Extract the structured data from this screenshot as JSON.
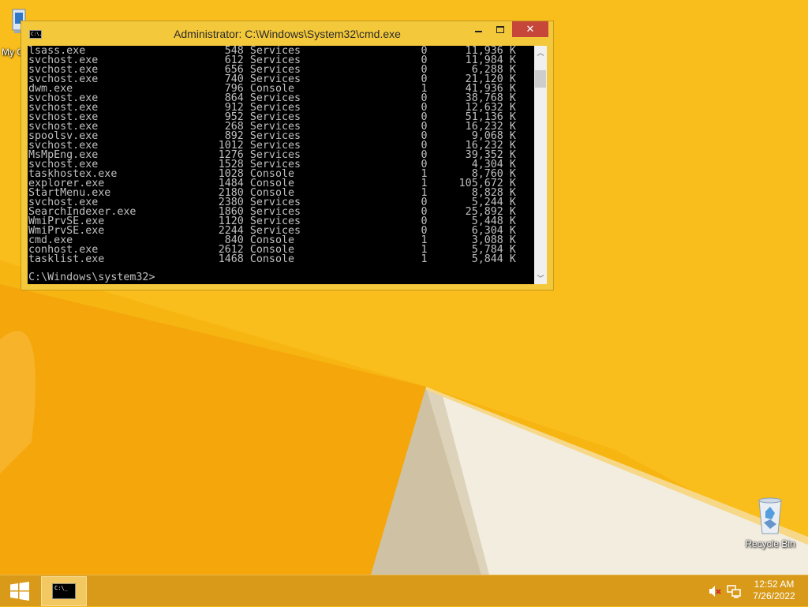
{
  "desktop": {
    "icons": {
      "my_computer": {
        "label": "My C"
      },
      "recycle_bin": {
        "label": "Recycle Bin"
      }
    }
  },
  "window": {
    "title": "Administrator: C:\\Windows\\System32\\cmd.exe",
    "sysicon_text": "C:\\.",
    "close_glyph": "✕"
  },
  "console": {
    "rows": [
      [
        "lsass.exe",
        "548",
        "Services",
        "0",
        "11,936",
        "K"
      ],
      [
        "svchost.exe",
        "612",
        "Services",
        "0",
        "11,984",
        "K"
      ],
      [
        "svchost.exe",
        "656",
        "Services",
        "0",
        "6,288",
        "K"
      ],
      [
        "svchost.exe",
        "740",
        "Services",
        "0",
        "21,120",
        "K"
      ],
      [
        "dwm.exe",
        "796",
        "Console",
        "1",
        "41,936",
        "K"
      ],
      [
        "svchost.exe",
        "864",
        "Services",
        "0",
        "38,768",
        "K"
      ],
      [
        "svchost.exe",
        "912",
        "Services",
        "0",
        "12,632",
        "K"
      ],
      [
        "svchost.exe",
        "952",
        "Services",
        "0",
        "51,136",
        "K"
      ],
      [
        "svchost.exe",
        "268",
        "Services",
        "0",
        "16,232",
        "K"
      ],
      [
        "spoolsv.exe",
        "892",
        "Services",
        "0",
        "9,068",
        "K"
      ],
      [
        "svchost.exe",
        "1012",
        "Services",
        "0",
        "16,232",
        "K"
      ],
      [
        "MsMpEng.exe",
        "1276",
        "Services",
        "0",
        "39,352",
        "K"
      ],
      [
        "svchost.exe",
        "1528",
        "Services",
        "0",
        "4,304",
        "K"
      ],
      [
        "taskhostex.exe",
        "1028",
        "Console",
        "1",
        "8,760",
        "K"
      ],
      [
        "explorer.exe",
        "1484",
        "Console",
        "1",
        "105,672",
        "K"
      ],
      [
        "StartMenu.exe",
        "2180",
        "Console",
        "1",
        "8,828",
        "K"
      ],
      [
        "svchost.exe",
        "2380",
        "Services",
        "0",
        "5,244",
        "K"
      ],
      [
        "SearchIndexer.exe",
        "1860",
        "Services",
        "0",
        "25,892",
        "K"
      ],
      [
        "WmiPrvSE.exe",
        "1120",
        "Services",
        "0",
        "5,448",
        "K"
      ],
      [
        "WmiPrvSE.exe",
        "2244",
        "Services",
        "0",
        "6,304",
        "K"
      ],
      [
        "cmd.exe",
        "840",
        "Console",
        "1",
        "3,088",
        "K"
      ],
      [
        "conhost.exe",
        "2612",
        "Console",
        "1",
        "5,784",
        "K"
      ],
      [
        "tasklist.exe",
        "1468",
        "Console",
        "1",
        "5,844",
        "K"
      ]
    ],
    "prompt": "C:\\Windows\\system32>"
  },
  "taskbar": {
    "task_icon_text": "C:\\_",
    "clock": {
      "time": "12:52 AM",
      "date": "7/26/2022"
    }
  },
  "colors": {
    "wallpaper": "#f8b814",
    "taskbar": "#d89a18",
    "window_frame": "#f3c83a",
    "close_button": "#c7463a",
    "console_bg": "#000000",
    "console_fg": "#c0c0c0"
  }
}
